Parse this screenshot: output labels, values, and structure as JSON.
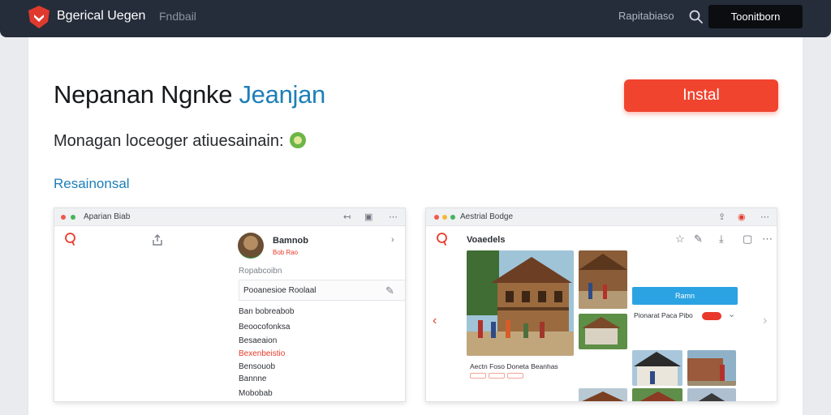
{
  "topbar": {
    "app_name": "Bgerical Uegen",
    "nav_link": "Fndbail",
    "right_link": "Rapitabiaso",
    "cta": "Toonitborn"
  },
  "hero": {
    "headline_main": "Nepanan Ngnke",
    "headline_accent": "Jeanjan",
    "install_label": "Instal",
    "subline": "Monagan loceoger atiuesainain:",
    "section_link": "Resainonsal"
  },
  "window_left": {
    "title": "Aparian Biab",
    "profile_name": "Bamnob",
    "profile_meta": "Bob Rao",
    "label_after_profile": "Ropabcoibn",
    "search_text": "Pooanesioe Roolaal",
    "list": [
      {
        "label": "Ban bobreabob",
        "red": false
      },
      {
        "label": "Beoocofonksa",
        "red": false
      },
      {
        "label": "Besaeaion",
        "red": false
      },
      {
        "label": "Bexenbeistio",
        "red": true
      },
      {
        "label": "Bensouob",
        "red": false
      },
      {
        "label": "Bannne",
        "red": false
      },
      {
        "label": "Mobobab",
        "red": false
      }
    ]
  },
  "window_right": {
    "title": "Aestrial Bodge",
    "heading": "Voaedels",
    "button_label": "Ramn",
    "detail_text": "Pionarat Paca Pibo",
    "caption": "Aectn Foso Doneta Beanhas"
  },
  "colors": {
    "topbar_bg": "#262d3a",
    "accent_blue": "#1c7fb8",
    "install_red": "#f0442f",
    "cta_blue": "#2ba3e2"
  }
}
